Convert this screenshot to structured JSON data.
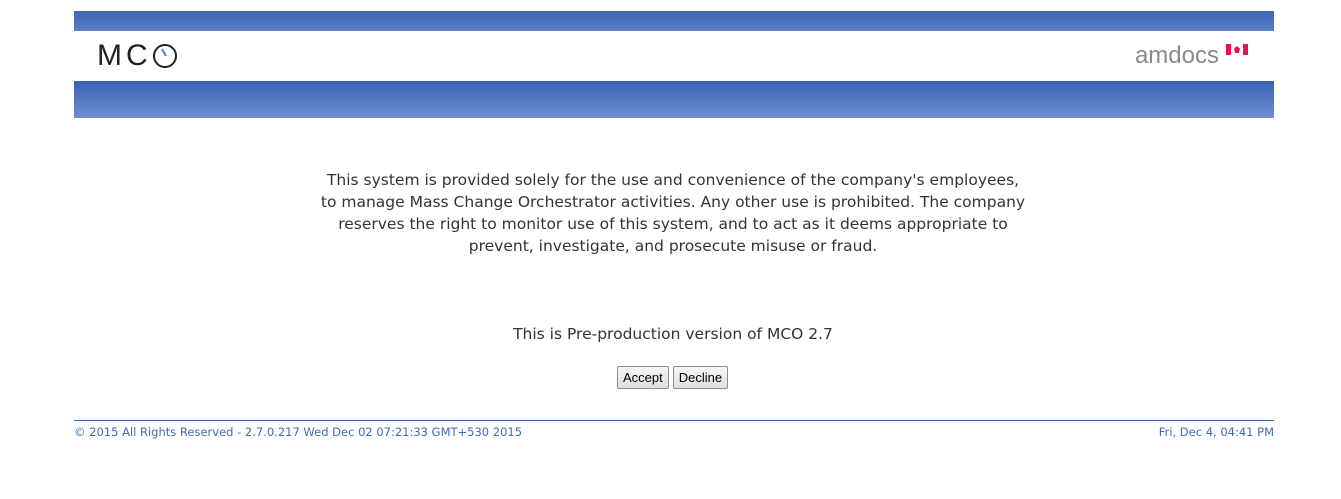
{
  "header": {
    "app_logo_text": "MC",
    "app_logo_icon": "clock-o-icon",
    "brand_logo_text": "amdocs",
    "brand_flag_icon": "canada-flag-icon",
    "top_bar_color": "#3e64b7",
    "bottom_bar_color": "#5a80c8"
  },
  "main": {
    "disclaimer": "This system is provided solely for the use and convenience of the company's employees, to manage Mass Change Orchestrator activities. Any other use is prohibited. The company reserves the right to monitor use of this system, and to act as it deems appropriate to prevent, investigate, and prosecute misuse or fraud.",
    "version_notice": "This is Pre-production version of MCO 2.7",
    "accept_label": "Accept",
    "decline_label": "Decline"
  },
  "footer": {
    "copyright": "© 2015 All Rights Reserved - 2.7.0.217 Wed Dec 02 07:21:33 GMT+530 2015",
    "datetime": "Fri, Dec 4, 04:41 PM",
    "accent_color": "#3d6bb3"
  }
}
